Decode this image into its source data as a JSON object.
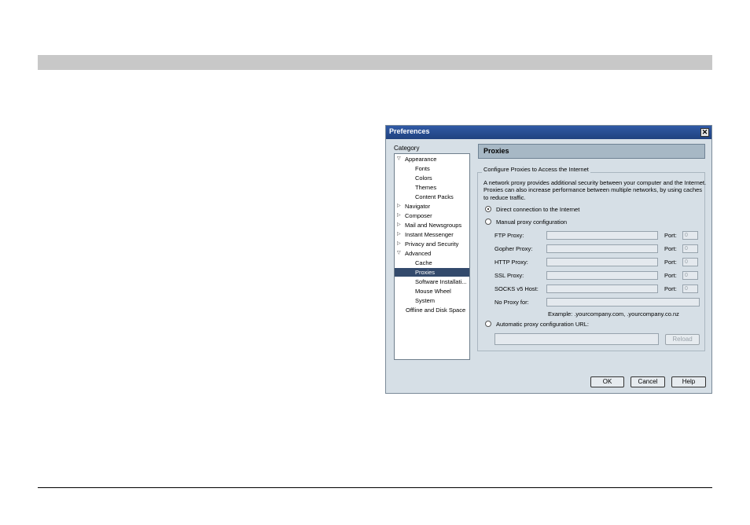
{
  "dialog": {
    "title": "Preferences",
    "close_glyph": "✕"
  },
  "category": {
    "label": "Category",
    "items": [
      {
        "label": "Appearance",
        "twisty": "▽"
      },
      {
        "label": "Fonts"
      },
      {
        "label": "Colors"
      },
      {
        "label": "Themes"
      },
      {
        "label": "Content Packs"
      },
      {
        "label": "Navigator",
        "twisty": "▷"
      },
      {
        "label": "Composer",
        "twisty": "▷"
      },
      {
        "label": "Mail and Newsgroups",
        "twisty": "▷"
      },
      {
        "label": "Instant Messenger",
        "twisty": "▷"
      },
      {
        "label": "Privacy and Security",
        "twisty": "▷"
      },
      {
        "label": "Advanced",
        "twisty": "▽"
      },
      {
        "label": "Cache"
      },
      {
        "label": "Proxies",
        "selected": true
      },
      {
        "label": "Software Installati..."
      },
      {
        "label": "Mouse Wheel"
      },
      {
        "label": "System"
      },
      {
        "label": "Offline and Disk Space"
      }
    ]
  },
  "panel": {
    "title": "Proxies",
    "group_legend": "Configure Proxies to Access the Internet",
    "description": "A network proxy provides additional security between your computer and the Internet. Proxies can also increase performance between multiple networks, by using caches to reduce traffic."
  },
  "options": {
    "direct": "Direct connection to the Internet",
    "manual": "Manual proxy configuration",
    "auto": "Automatic proxy configuration URL:",
    "selected": "direct"
  },
  "proxies": [
    {
      "label": "FTP Proxy:",
      "value": "",
      "port_label": "Port:",
      "port": "0"
    },
    {
      "label": "Gopher Proxy:",
      "value": "",
      "port_label": "Port:",
      "port": "0"
    },
    {
      "label": "HTTP Proxy:",
      "value": "",
      "port_label": "Port:",
      "port": "0"
    },
    {
      "label": "SSL Proxy:",
      "value": "",
      "port_label": "Port:",
      "port": "0"
    },
    {
      "label": "SOCKS v5 Host:",
      "value": "",
      "port_label": "Port:",
      "port": "0"
    }
  ],
  "no_proxy": {
    "label": "No Proxy for:",
    "value": "",
    "example": "Example: .yourcompany.com, .yourcompany.co.nz"
  },
  "auto_url": {
    "value": "",
    "reload_label": "Reload"
  },
  "buttons": {
    "ok": "OK",
    "cancel": "Cancel",
    "help": "Help"
  },
  "colors": {
    "titlebar": "#2b4f94",
    "selection": "#334a6c",
    "dialog_bg": "#d6dfe6"
  }
}
